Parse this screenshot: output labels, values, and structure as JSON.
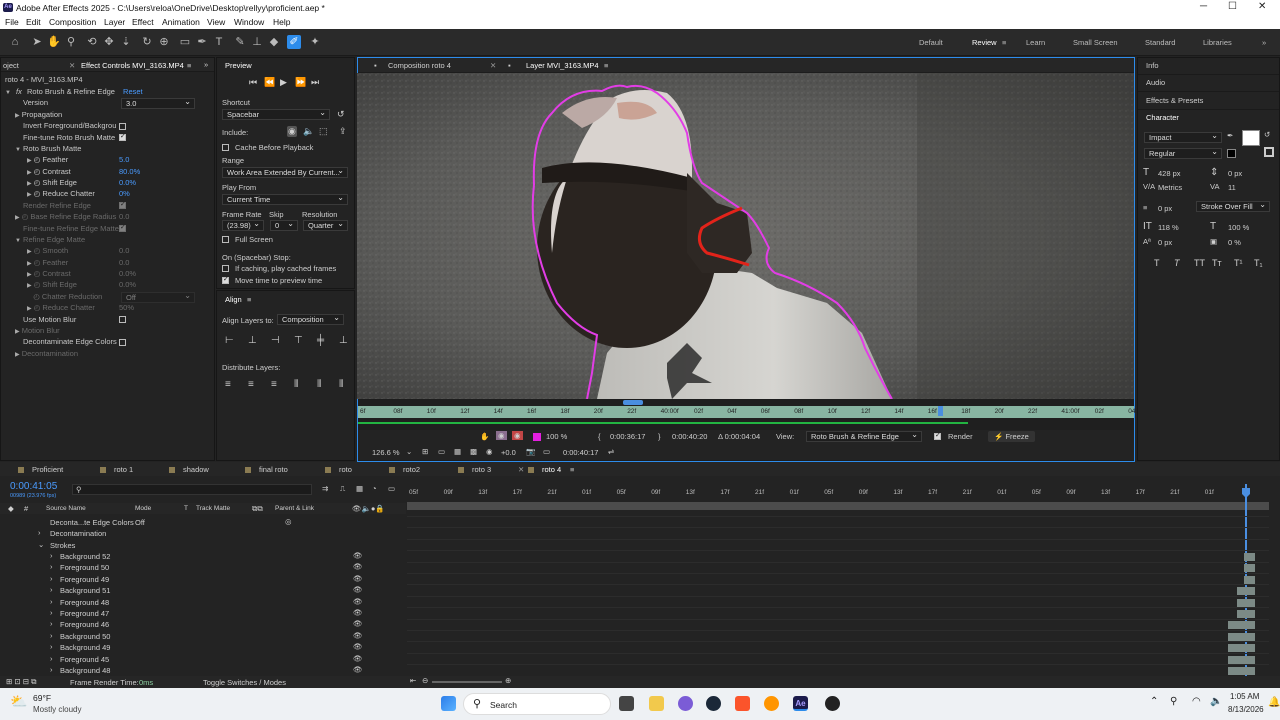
{
  "window": {
    "title": "Adobe After Effects 2025 - C:\\Users\\reloa\\OneDrive\\Desktop\\rellyy\\proficient.aep *",
    "ae": "Ae"
  },
  "menu": [
    "File",
    "Edit",
    "Composition",
    "Layer",
    "Effect",
    "Animation",
    "View",
    "Window",
    "Help"
  ],
  "workspaces": [
    "Default",
    "Review",
    "Learn",
    "Small Screen",
    "Standard",
    "Libraries"
  ],
  "effect_controls": {
    "tab_project": "oject",
    "tab": "Effect Controls MVI_3163.MP4",
    "layer_title": "roto 4 - MVI_3163.MP4",
    "effect_name": "Roto Brush & Refine Edge",
    "reset": "Reset",
    "fx": "fx",
    "rows": [
      {
        "label": "Version",
        "value": "3.0"
      },
      {
        "label": "Propagation"
      },
      {
        "label": "Invert Foreground/Backgrou"
      },
      {
        "label": "Fine-tune Roto Brush Matte"
      },
      {
        "label": "Roto Brush Matte"
      },
      {
        "label": "Feather",
        "value": "5.0"
      },
      {
        "label": "Contrast",
        "value": "80.0%"
      },
      {
        "label": "Shift Edge",
        "value": "0.0%"
      },
      {
        "label": "Reduce Chatter",
        "value": "0%"
      },
      {
        "label": "Render Refine Edge"
      },
      {
        "label": "Base Refine Edge Radius",
        "value": "0.0"
      },
      {
        "label": "Fine-tune Refine Edge Matte"
      },
      {
        "label": "Refine Edge Matte"
      },
      {
        "label": "Smooth",
        "value": "0.0"
      },
      {
        "label": "Feather",
        "value": "0.0"
      },
      {
        "label": "Contrast",
        "value": "0.0%"
      },
      {
        "label": "Shift Edge",
        "value": "0.0%"
      },
      {
        "label": "Chatter Reduction",
        "value": "Off"
      },
      {
        "label": "Reduce Chatter",
        "value": "50%"
      },
      {
        "label": "Use Motion Blur"
      },
      {
        "label": "Motion Blur"
      },
      {
        "label": "Decontaminate Edge Colors"
      },
      {
        "label": "Decontamination"
      }
    ]
  },
  "preview": {
    "title": "Preview",
    "shortcut_label": "Shortcut",
    "shortcut": "Spacebar",
    "include_label": "Include:",
    "cache_label": "Cache Before Playback",
    "range_label": "Range",
    "range": "Work Area Extended By Current...",
    "playfrom_label": "Play From",
    "playfrom": "Current Time",
    "framerate_label": "Frame Rate",
    "skip_label": "Skip",
    "resolution_label": "Resolution",
    "framerate": "(23.98)",
    "skip": "0",
    "resolution": "Quarter",
    "fullscreen": "Full Screen",
    "onstop_label": "On (Spacebar) Stop:",
    "ifcaching": "If caching, play cached frames",
    "movetime": "Move time to preview time"
  },
  "align": {
    "title": "Align",
    "align_to_label": "Align Layers to:",
    "align_to": "Composition",
    "distribute": "Distribute Layers:"
  },
  "viewer": {
    "tab1": "Composition roto 4",
    "tab2": "Layer MVI_3163.MP4",
    "ruler": [
      "6f",
      "08f",
      "10f",
      "12f",
      "14f",
      "16f",
      "18f",
      "20f",
      "22f",
      "40:00f",
      "02f",
      "04f",
      "06f",
      "08f",
      "10f",
      "12f",
      "14f",
      "16f",
      "18f",
      "20f",
      "22f",
      "41:00f",
      "02f",
      "04f"
    ],
    "zoom_small": "100 %",
    "time_in": "0:00:36:17",
    "time_out": "0:00:40:20",
    "duration": "Δ 0:00:04:04",
    "view_label": "View:",
    "view": "Roto Brush & Refine Edge",
    "render": "Render",
    "freeze": "Freeze",
    "zoom": "126.6 %",
    "exposure": "+0.0",
    "current": "0:00:40:17"
  },
  "right_panels": {
    "info": "Info",
    "audio": "Audio",
    "effects": "Effects & Presets",
    "character": "Character",
    "font": "Impact",
    "style": "Regular",
    "size": "428 px",
    "leading": "0 px",
    "kerning": "Metrics",
    "tracking": "11",
    "stroke_w": "0 px",
    "stroke_type": "Stroke Over Fill",
    "vscale": "118 %",
    "hscale": "100 %",
    "baseline": "0 px",
    "tsume": "0 %",
    "typo": [
      "T",
      "T",
      "TT",
      "Tт",
      "T¹",
      "T₁"
    ]
  },
  "timeline": {
    "tabs": [
      "Proficient",
      "roto 1",
      "shadow",
      "final roto",
      "roto",
      "roto2",
      "roto 3",
      "roto 4"
    ],
    "timecode": "0:00:41:05",
    "fps": "00989 (23.976 fps)",
    "search_placeholder": "",
    "cols": {
      "source": "Source Name",
      "mode": "Mode",
      "t": "T",
      "matte": "Track Matte",
      "parent": "Parent & Link"
    },
    "ruler": [
      "05f",
      "09f",
      "13f",
      "17f",
      "21f",
      "01f",
      "05f",
      "09f",
      "13f",
      "17f",
      "21f",
      "01f",
      "05f",
      "09f",
      "13f",
      "17f",
      "21f",
      "01f",
      "05f",
      "09f",
      "13f",
      "17f",
      "21f",
      "01f"
    ],
    "rows": [
      {
        "name": "Decontа...te Edge Colors",
        "value": "Off"
      },
      {
        "name": "Decontamination"
      },
      {
        "name": "Strokes"
      },
      {
        "name": "Background 52"
      },
      {
        "name": "Foreground 50"
      },
      {
        "name": "Foreground 49"
      },
      {
        "name": "Background 51"
      },
      {
        "name": "Foreground 48"
      },
      {
        "name": "Foreground 47"
      },
      {
        "name": "Foreground 46"
      },
      {
        "name": "Background 50"
      },
      {
        "name": "Background 49"
      },
      {
        "name": "Foreground 45"
      },
      {
        "name": "Background 48"
      }
    ],
    "render_time_label": "Frame Render Time:",
    "render_time": "0ms",
    "toggle": "Toggle Switches / Modes"
  },
  "taskbar": {
    "temp": "69°F",
    "weather": "Mostly cloudy",
    "search": "Search",
    "time": "1:05 AM",
    "date": "8/13/2026"
  }
}
